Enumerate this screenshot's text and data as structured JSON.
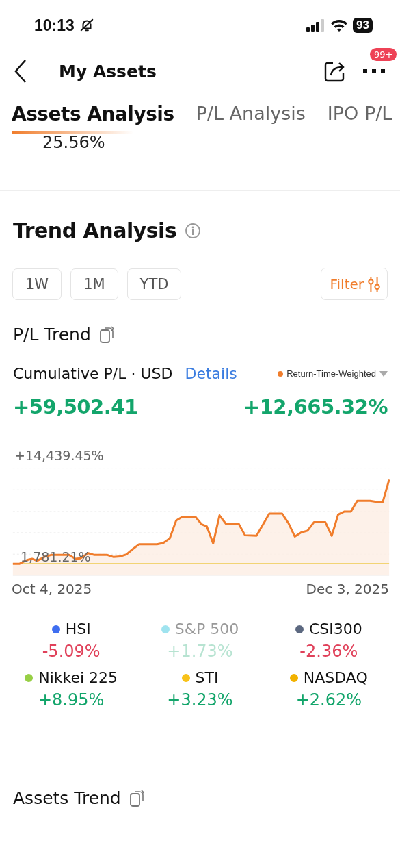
{
  "status_bar": {
    "time": "10:13",
    "battery": "93"
  },
  "header": {
    "title": "My Assets",
    "badge": "99+"
  },
  "tabs": [
    {
      "label": "Assets Analysis",
      "selected": true
    },
    {
      "label": "P/L Analysis",
      "selected": false
    },
    {
      "label": "IPO P/L",
      "selected": false
    }
  ],
  "peek_value": "25.56%",
  "trend": {
    "title": "Trend Analysis",
    "periods": [
      {
        "label": "1W",
        "selected": false
      },
      {
        "label": "1M",
        "selected": false
      },
      {
        "label": "YTD",
        "selected": false
      }
    ],
    "filter": "Filter",
    "pl_trend": {
      "title": "P/L Trend",
      "metric": "Cumulative P/L · USD",
      "details": "Details",
      "mode": {
        "label": "Return-Time-Weighted",
        "color": "#f07d2c"
      },
      "amount": "+59,502.41",
      "return": "+12,665.32%",
      "chart": {
        "kind": "picture",
        "top_label": "+14,439.45%",
        "bottom_label": "1,781.21%",
        "start_date": "Oct 4, 2025",
        "end_date": "Dec 3, 2025"
      }
    },
    "indices": [
      {
        "name": "HSI",
        "color": "#3f6ef0",
        "change": "-5.09%",
        "kind": "down",
        "selected": true
      },
      {
        "name": "S&P 500",
        "color": "#9fe3ef",
        "change": "+1.73%",
        "kind": "up",
        "selected": false
      },
      {
        "name": "CSI300",
        "color": "#5c6880",
        "change": "-2.36%",
        "kind": "down",
        "selected": true
      },
      {
        "name": "Nikkei 225",
        "color": "#97cf45",
        "change": "+8.95%",
        "kind": "up",
        "selected": true
      },
      {
        "name": "STI",
        "color": "#f8c21a",
        "change": "+3.23%",
        "kind": "up",
        "selected": true
      },
      {
        "name": "NASDAQ",
        "color": "#f2b200",
        "change": "+2.62%",
        "kind": "up",
        "selected": true
      }
    ]
  },
  "assets_trend": {
    "title": "Assets Trend"
  }
}
